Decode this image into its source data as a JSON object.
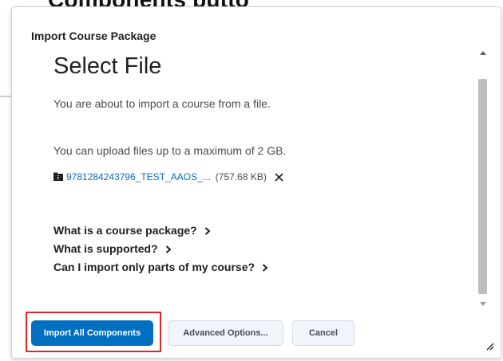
{
  "background": {
    "cut_heading": "Components butto"
  },
  "dialog": {
    "title": "Import Course Package",
    "heading": "Select File",
    "intro": "You are about to import a course from a file.",
    "max_size_text": "You can upload files up to a maximum of 2 GB.",
    "file": {
      "name": "9781284243796_TEST_AAOS_...",
      "size": "(757.68 KB)",
      "icon": "file-archive-icon",
      "remove_icon": "close-icon"
    },
    "help_links": [
      {
        "label": "What is a course package?"
      },
      {
        "label": "What is supported?"
      },
      {
        "label": "Can I import only parts of my course?"
      }
    ],
    "buttons": {
      "primary": "Import All Components",
      "advanced": "Advanced Options...",
      "cancel": "Cancel"
    }
  },
  "colors": {
    "primary": "#006fbf",
    "link": "#006fbf",
    "highlight": "#e0262a",
    "secondary_bg": "#f1f5fb"
  }
}
